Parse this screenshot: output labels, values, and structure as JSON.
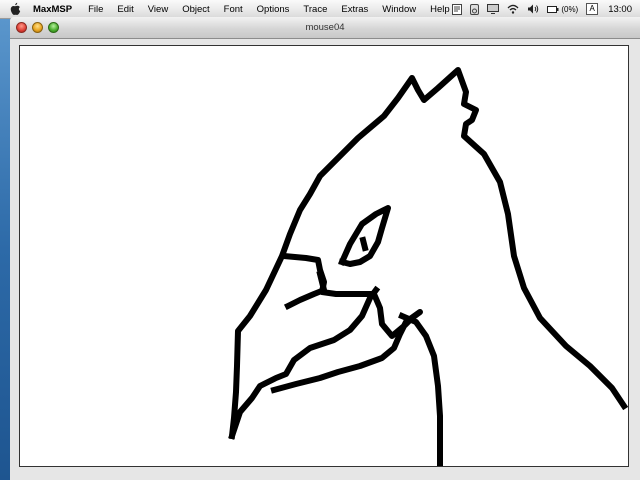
{
  "menubar": {
    "app_name": "MaxMSP",
    "items": [
      "File",
      "Edit",
      "View",
      "Object",
      "Font",
      "Options",
      "Trace",
      "Extras",
      "Window",
      "Help"
    ],
    "battery": "(0%)",
    "input_menu": "A",
    "clock": "13:00"
  },
  "window": {
    "title": "mouse04"
  },
  "colors": {
    "stroke": "#000000",
    "canvas": "#ffffff"
  }
}
